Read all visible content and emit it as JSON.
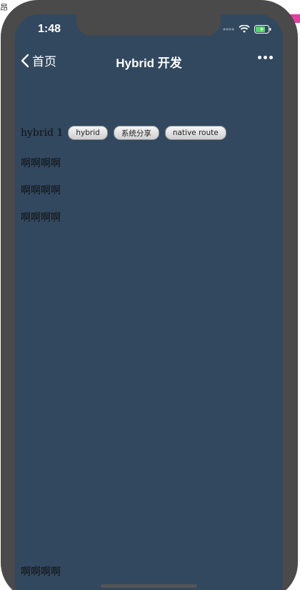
{
  "desktop": {
    "fragment_left": "昂",
    "accent_color": "#e040a0"
  },
  "status_bar": {
    "time": "1:48",
    "icons": [
      "signal-dots-icon",
      "wifi-icon",
      "battery-charging-icon"
    ],
    "battery_color": "#4cd964"
  },
  "nav": {
    "back_label": "首页",
    "title": "Hybrid 开发",
    "more_icon": "more-dots-icon"
  },
  "content": {
    "row_label": "hybrid 1",
    "buttons": [
      {
        "label": "hybrid"
      },
      {
        "label": "系统分享"
      },
      {
        "label": "native route"
      }
    ],
    "paragraphs": [
      "啊啊啊啊",
      "啊啊啊啊",
      "啊啊啊啊"
    ],
    "bottom_text": "啊啊啊啊"
  },
  "colors": {
    "background": "#31485f",
    "phone_frame": "#4a4a4a",
    "text": "#111111"
  }
}
